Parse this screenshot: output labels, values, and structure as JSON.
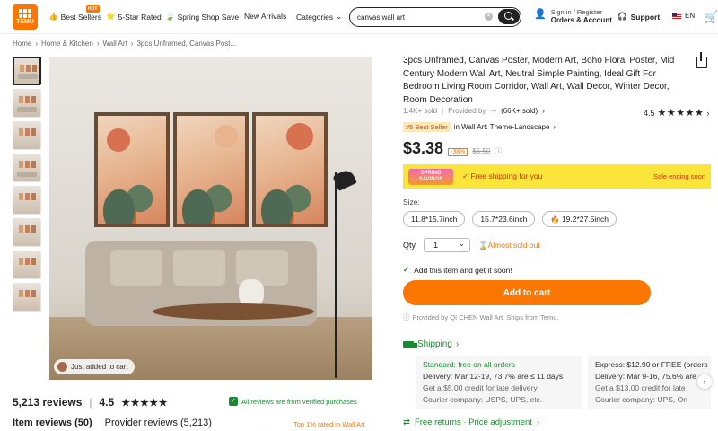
{
  "header": {
    "logo_text": "TEMU",
    "nav": [
      {
        "label": "Best Sellers",
        "badge": "HOT"
      },
      {
        "label": "5-Star Rated"
      },
      {
        "label": "Spring Shop Save"
      },
      {
        "label": "New Arrivals"
      },
      {
        "label": "Categories"
      }
    ],
    "search_value": "canvas wall art",
    "signin_line1": "Sign in / Register",
    "signin_line2": "Orders & Account",
    "support": "Support",
    "lang": "EN"
  },
  "breadcrumb": [
    "Home",
    "Home & Kitchen",
    "Wall Art",
    "3pcs Unframed, Canvas Post..."
  ],
  "gallery": {
    "added_text": "Just added to cart"
  },
  "reviews": {
    "count": "5,213 reviews",
    "rating": "4.5",
    "stars": "★★★★★",
    "verified": "All reviews are from verified purchases",
    "tab_item": "Item reviews (50)",
    "tab_provider": "Provider reviews (5,213)",
    "top_rated": "Top 1% rated in Wall Art"
  },
  "product": {
    "title": "3pcs Unframed, Canvas Poster, Modern Art, Boho Floral Poster, Mid Century Modern Wall Art, Neutral Simple Painting, Ideal Gift For Bedroom Living Room Corridor, Wall Art, Wall Decor, Winter Decor, Room Decoration",
    "sold": "1.4K+ sold",
    "provided_by": "Provided by",
    "provider_sold": "(66K+ sold)",
    "rating": "4.5",
    "stars": "★★★★★",
    "best_badge": "#5 Best Seller",
    "best_category": "in Wall Art: Theme-Landscape",
    "price": "$3.38",
    "discount": "-38%",
    "original_price": "$5.50",
    "promo_badge": "SPRING SAVINGS",
    "free_shipping": "Free shipping for you",
    "sale_ending": "Sale ending soon",
    "size_label": "Size:",
    "sizes": [
      "11.8*15.7inch",
      "15.7*23.6inch",
      "19.2*27.5inch"
    ],
    "qty_label": "Qty",
    "qty_value": "1",
    "almost_sold": "Almost sold out",
    "add_note": "Add this item and get it soon!",
    "add_to_cart": "Add to cart",
    "provided_note": "Provided by QI CHEN Wall Art. Ships from Temu."
  },
  "shipping": {
    "title": "Shipping",
    "standard": {
      "line1": "Standard: free on all orders",
      "line2": "Delivery: Mar 12-19, 73.7% are ≤ 11 days",
      "line3": "Get a $5.00 credit for late delivery",
      "line4": "Courier company:  USPS,  UPS, etc."
    },
    "express": {
      "line1": "Express: $12.90 or FREE (orders",
      "line2": "Delivery: Mar 9-16, 75.6% are",
      "line3": "Get a $13.00 credit for late",
      "line4": "Courier company:  UPS,  On"
    },
    "returns": "Free returns · Price adjustment"
  }
}
